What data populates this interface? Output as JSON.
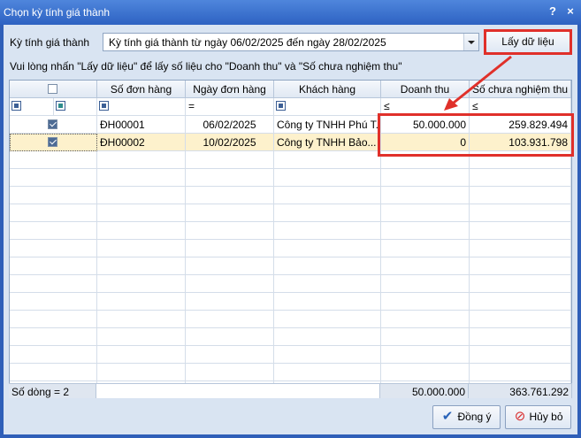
{
  "window": {
    "title": "Chọn kỳ tính giá thành",
    "help_label": "?",
    "close_label": "×"
  },
  "period": {
    "label": "Kỳ tính giá thành",
    "value": "Kỳ tính giá thành từ ngày 06/02/2025 đến ngày 28/02/2025"
  },
  "get_data_button": "Lấy dữ liệu",
  "instruction": "Vui lòng nhấn \"Lấy dữ liệu\" để lấy số liệu cho \"Doanh thu\" và \"Số chưa nghiệm thu\"",
  "grid": {
    "columns": [
      "",
      "Số đơn hàng",
      "Ngày đơn hàng",
      "Khách hàng",
      "Doanh thu",
      "Số chưa nghiệm thu"
    ],
    "filter_ops": {
      "date": "=",
      "revenue": "≤",
      "unaccepted": "≤"
    },
    "rows": [
      {
        "checked": true,
        "order_no": "ĐH00001",
        "order_date": "06/02/2025",
        "customer": "Công ty TNHH Phú T...",
        "revenue": "50.000.000",
        "unaccepted": "259.829.494"
      },
      {
        "checked": true,
        "order_no": "ĐH00002",
        "order_date": "10/02/2025",
        "customer": "Công ty TNHH Bảo...",
        "revenue": "0",
        "unaccepted": "103.931.798"
      }
    ],
    "footer": {
      "count": "Số dòng = 2",
      "revenue_total": "50.000.000",
      "unaccepted_total": "363.761.292"
    }
  },
  "buttons": {
    "ok": "Đồng ý",
    "cancel": "Hủy bỏ"
  },
  "colors": {
    "highlight": "#e0302a",
    "selected_row": "#fdf1cc",
    "title_bar": "#2d62c2"
  },
  "icons": {
    "ok": "check-icon",
    "cancel": "cancel-icon"
  }
}
